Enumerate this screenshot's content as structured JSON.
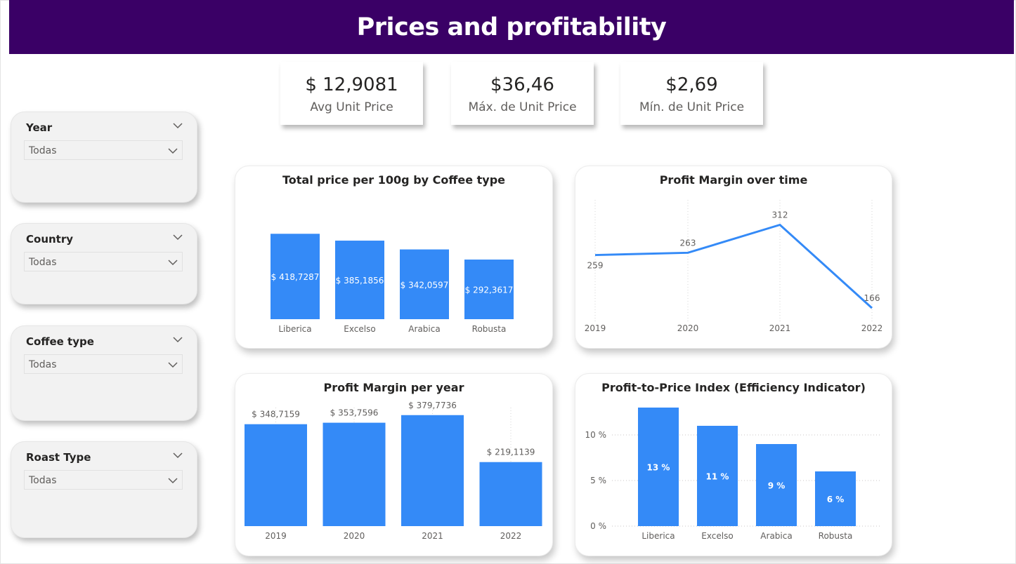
{
  "header": {
    "title": "Prices and profitability"
  },
  "kpis": [
    {
      "value": "$ 12,9081",
      "label": "Avg Unit Price"
    },
    {
      "value": "$36,46",
      "label": "Máx. de Unit Price"
    },
    {
      "value": "$2,69",
      "label": "Mín. de Unit Price"
    }
  ],
  "slicers": [
    {
      "title": "Year",
      "value": "Todas"
    },
    {
      "title": "Country",
      "value": "Todas"
    },
    {
      "title": "Coffee type",
      "value": "Todas"
    },
    {
      "title": "Roast Type",
      "value": "Todas"
    }
  ],
  "colors": {
    "header": "#3a0066",
    "bar": "#348af7",
    "gridline": "#c8c6c4"
  },
  "chart_data": [
    {
      "type": "bar",
      "title": "Total price per 100g by Coffee type",
      "categories": [
        "Liberica",
        "Excelso",
        "Arabica",
        "Robusta"
      ],
      "values": [
        418.7287,
        385.1856,
        342.0597,
        292.3617
      ],
      "data_labels": [
        "$ 418,7287",
        "$ 385,1856",
        "$ 342,0597",
        "$ 292,3617"
      ],
      "label_position": "inside",
      "ylim": [
        0,
        430
      ]
    },
    {
      "type": "line",
      "title": "Profit Margin over time",
      "x": [
        "2019",
        "2020",
        "2021",
        "2022"
      ],
      "values": [
        259,
        263,
        312,
        166
      ],
      "data_labels": [
        "259",
        "263",
        "312",
        "166"
      ],
      "ylim": [
        160,
        320
      ]
    },
    {
      "type": "bar",
      "title": "Profit Margin per year",
      "categories": [
        "2019",
        "2020",
        "2021",
        "2022"
      ],
      "values": [
        348.7159,
        353.7596,
        379.7736,
        219.1139
      ],
      "data_labels": [
        "$ 348,7159",
        "$ 353,7596",
        "$ 379,7736",
        "$ 219,1139"
      ],
      "label_position": "outside",
      "ylim": [
        0,
        420
      ]
    },
    {
      "type": "bar",
      "title": "Profit-to-Price Index (Efficiency Indicator)",
      "categories": [
        "Liberica",
        "Excelso",
        "Arabica",
        "Robusta"
      ],
      "values": [
        13,
        11,
        9,
        6
      ],
      "data_labels": [
        "13 %",
        "11 %",
        "9 %",
        "6 %"
      ],
      "label_position": "inside",
      "yticks": [
        "0 %",
        "5 %",
        "10 %"
      ],
      "ytick_values": [
        0,
        5,
        10
      ],
      "ylim": [
        0,
        13
      ],
      "grid": true
    }
  ]
}
